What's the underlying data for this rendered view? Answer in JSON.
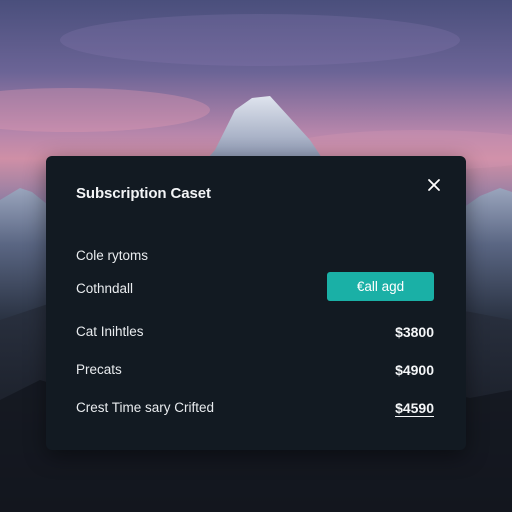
{
  "dialog": {
    "title": "Subscription Caset",
    "close_icon": "close-icon",
    "section_label": "Cole rytoms",
    "plan_name": "Cothndall",
    "action_label": "€all agd",
    "accent_color": "#1ab0a6",
    "background_color": "#121a22",
    "rows": [
      {
        "label": "Cat Inihtles",
        "value": "$3800"
      },
      {
        "label": "Precats",
        "value": "$4900"
      },
      {
        "label": "Crest Time sary Crifted",
        "value": "$4590"
      }
    ]
  }
}
